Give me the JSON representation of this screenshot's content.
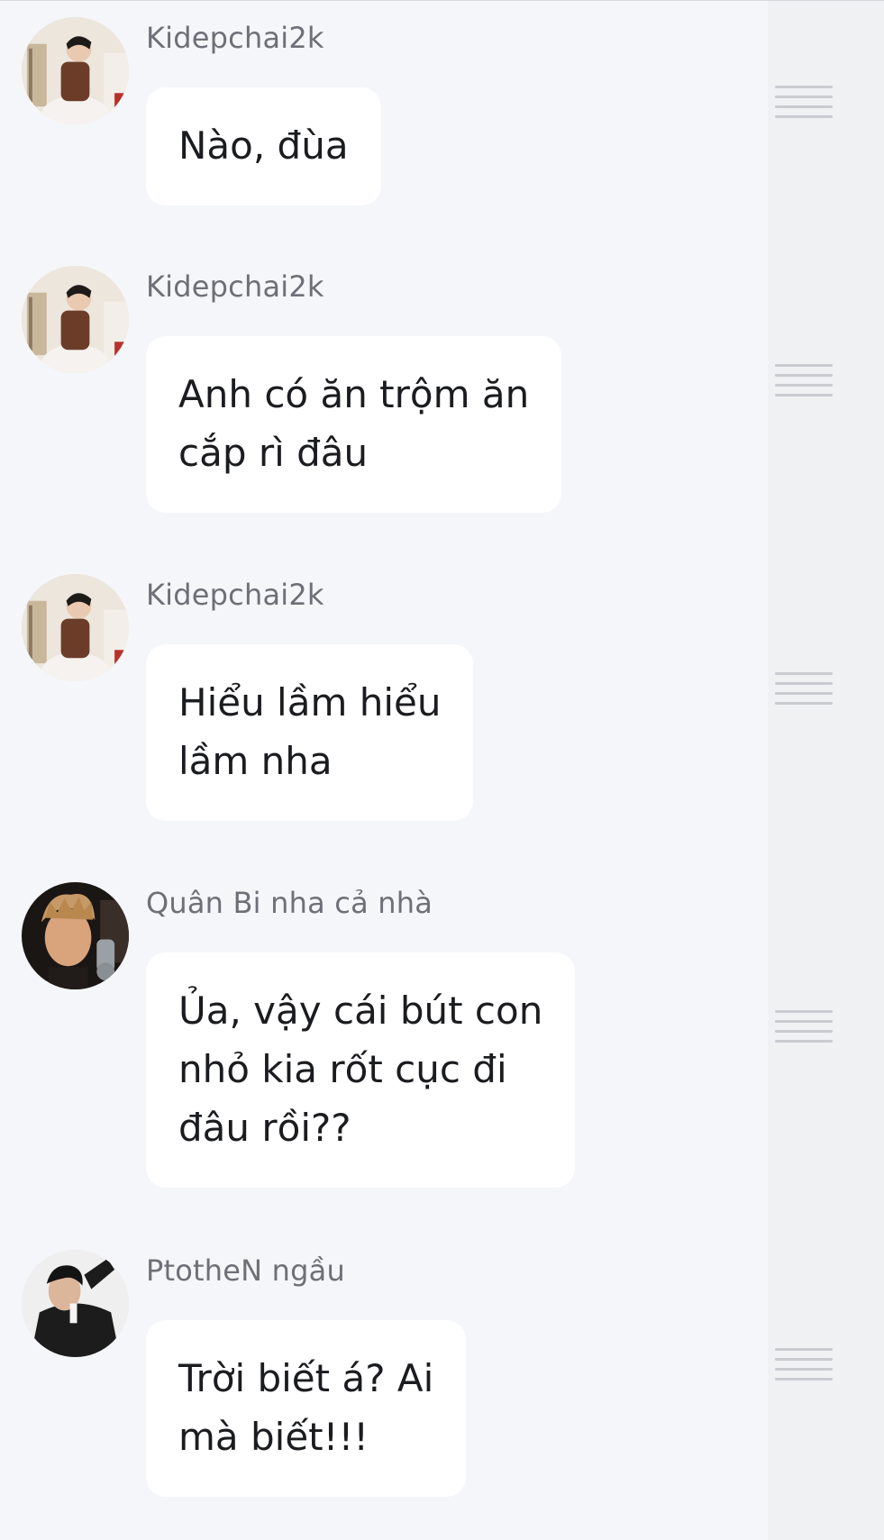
{
  "messages": [
    {
      "sender": "Kidepchai2k",
      "text": "Nào, đùa",
      "avatar": "kidepchai2k-avatar"
    },
    {
      "sender": "Kidepchai2k",
      "text": "Anh có ăn trộm ăn\ncắp rì đâu",
      "avatar": "kidepchai2k-avatar"
    },
    {
      "sender": "Kidepchai2k",
      "text": "Hiểu lầm hiểu\nlầm nha",
      "avatar": "kidepchai2k-avatar"
    },
    {
      "sender": "Quân Bi nha cả nhà",
      "text": "Ủa, vậy cái bút con\nnhỏ kia rốt cục đi\nđâu rồi??",
      "avatar": "quanbi-avatar"
    },
    {
      "sender": "PtotheN ngầu",
      "text": "Trời biết á? Ai\nmà biết!!!",
      "avatar": "ptothen-avatar"
    }
  ],
  "drag_handle_icon": "drag-handle-icon",
  "colors": {
    "background": "#f5f6f9",
    "bubble": "#ffffff",
    "sender_text": "#6d7078",
    "message_text": "#1b1c1f",
    "side_panel": "#f0f1f3",
    "handle": "#c9cbd0"
  }
}
